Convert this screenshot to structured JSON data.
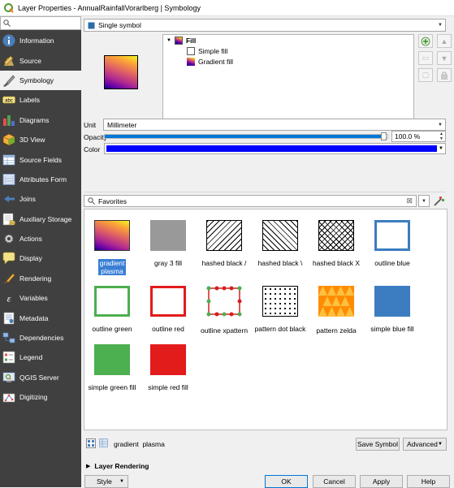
{
  "window": {
    "title": "Layer Properties - AnnualRainfallVorarlberg | Symbology"
  },
  "sidebar": {
    "search_placeholder": "",
    "items": [
      {
        "label": "Information",
        "icon": "information-icon"
      },
      {
        "label": "Source",
        "icon": "source-icon"
      },
      {
        "label": "Symbology",
        "icon": "symbology-icon"
      },
      {
        "label": "Labels",
        "icon": "labels-icon"
      },
      {
        "label": "Diagrams",
        "icon": "diagrams-icon"
      },
      {
        "label": "3D View",
        "icon": "3d-view-icon"
      },
      {
        "label": "Source Fields",
        "icon": "source-fields-icon"
      },
      {
        "label": "Attributes Form",
        "icon": "attributes-form-icon"
      },
      {
        "label": "Joins",
        "icon": "joins-icon"
      },
      {
        "label": "Auxiliary Storage",
        "icon": "auxiliary-storage-icon"
      },
      {
        "label": "Actions",
        "icon": "actions-icon"
      },
      {
        "label": "Display",
        "icon": "display-icon"
      },
      {
        "label": "Rendering",
        "icon": "rendering-icon"
      },
      {
        "label": "Variables",
        "icon": "variables-icon"
      },
      {
        "label": "Metadata",
        "icon": "metadata-icon"
      },
      {
        "label": "Dependencies",
        "icon": "dependencies-icon"
      },
      {
        "label": "Legend",
        "icon": "legend-icon"
      },
      {
        "label": "QGIS Server",
        "icon": "qgis-server-icon"
      },
      {
        "label": "Digitizing",
        "icon": "digitizing-icon"
      }
    ],
    "active_index": 2
  },
  "renderer": {
    "value": "Single symbol"
  },
  "layers_tree": {
    "fill": "Fill",
    "simple_fill": "Simple fill",
    "gradient_fill": "Gradient fill"
  },
  "unit": {
    "label": "Unit",
    "value": "Millimeter"
  },
  "opacity": {
    "label": "Opacity",
    "value": "100.0 %",
    "fraction": 1.0
  },
  "color": {
    "label": "Color",
    "value": "#0000ff"
  },
  "library": {
    "search_value": "Favorites",
    "symbols": [
      {
        "name": "gradient plasma",
        "name_line1": "gradient",
        "name_line2": "plasma",
        "selected": true
      },
      {
        "name": "gray 3 fill"
      },
      {
        "name": "hashed black /"
      },
      {
        "name": "hashed black \\"
      },
      {
        "name": "hashed black X"
      },
      {
        "name": "outline blue"
      },
      {
        "name": "outline green"
      },
      {
        "name": "outline red"
      },
      {
        "name": "outline xpattern"
      },
      {
        "name": "pattern dot black"
      },
      {
        "name": "pattern zelda"
      },
      {
        "name": "simple blue fill"
      },
      {
        "name": "simple green fill"
      },
      {
        "name": "simple red fill"
      }
    ]
  },
  "bottom_bar": {
    "selected_name": "gradient  plasma",
    "save_symbol": "Save Symbol",
    "advanced": "Advanced"
  },
  "layer_rendering": {
    "label": "Layer Rendering"
  },
  "footer": {
    "style": "Style",
    "ok": "OK",
    "cancel": "Cancel",
    "apply": "Apply",
    "help": "Help"
  },
  "colors": {
    "sidebar_bg": "#404040",
    "accent": "#3a7fd5",
    "blue": "#3b7dc0",
    "green": "#4caf50",
    "red": "#e21b1b"
  }
}
